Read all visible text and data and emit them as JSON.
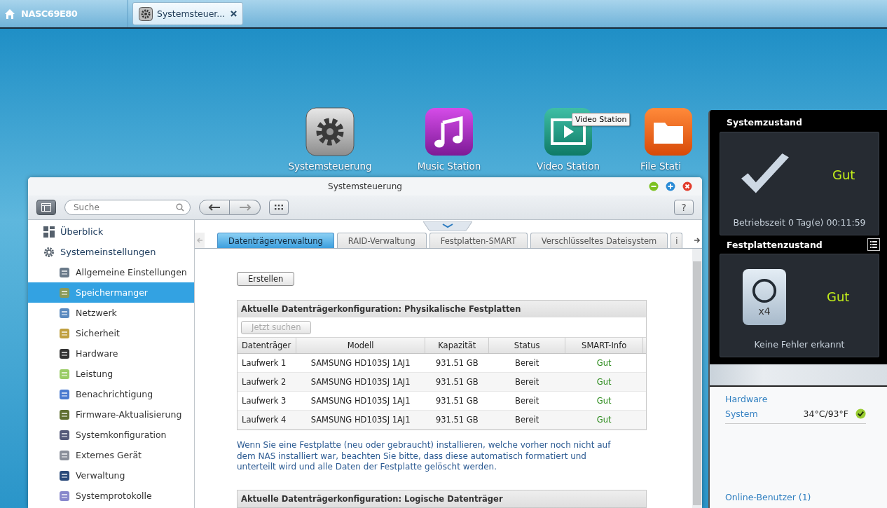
{
  "taskbar": {
    "home_label": "NASC69E80",
    "tabs": [
      {
        "label": "Systemsteuer...",
        "selected": true
      }
    ]
  },
  "desktop_icons": [
    {
      "label": "Systemsteuerung",
      "kind": "gear"
    },
    {
      "label": "Music Station",
      "kind": "music"
    },
    {
      "label": "Video Station",
      "kind": "video"
    },
    {
      "label": "File Stati",
      "kind": "folder"
    }
  ],
  "tooltip": "Video Station",
  "window": {
    "title": "Systemsteuerung",
    "search": {
      "placeholder": "Suche"
    },
    "help_label": "?",
    "sidebar": [
      {
        "label": "Überblick",
        "kind": "overview",
        "selected": false
      },
      {
        "label": "Systemeinstellungen",
        "kind": "settings",
        "selected": false,
        "children": [
          {
            "label": "Allgemeine Einstellungen",
            "selected": false
          },
          {
            "label": "Speichermanger",
            "selected": true
          },
          {
            "label": "Netzwerk",
            "selected": false
          },
          {
            "label": "Sicherheit",
            "selected": false
          },
          {
            "label": "Hardware",
            "selected": false
          },
          {
            "label": "Leistung",
            "selected": false
          },
          {
            "label": "Benachrichtigung",
            "selected": false
          },
          {
            "label": "Firmware-Aktualisierung",
            "selected": false
          },
          {
            "label": "Systemkonfiguration",
            "selected": false
          },
          {
            "label": "Externes Gerät",
            "selected": false
          },
          {
            "label": "Verwaltung",
            "selected": false
          },
          {
            "label": "Systemprotokolle",
            "selected": false
          }
        ]
      }
    ],
    "tabs": [
      {
        "label": "Datenträgerverwaltung",
        "selected": true
      },
      {
        "label": "RAID-Verwaltung",
        "selected": false
      },
      {
        "label": "Festplatten-SMART",
        "selected": false
      },
      {
        "label": "Verschlüsseltes Dateisystem",
        "selected": false
      },
      {
        "label": "i",
        "selected": false
      }
    ],
    "create_button": "Erstellen",
    "physical": {
      "title": "Aktuelle Datenträgerkonfiguration: Physikalische Festplatten",
      "scan_button": {
        "label": "Jetzt suchen",
        "disabled": true
      },
      "columns": [
        "Datenträger",
        "Modell",
        "Kapazität",
        "Status",
        "SMART-Info"
      ],
      "rows": [
        {
          "cells": [
            "Laufwerk 1",
            "SAMSUNG HD103SJ 1AJ1",
            "931.51 GB",
            "Bereit",
            "Gut"
          ]
        },
        {
          "cells": [
            "Laufwerk 2",
            "SAMSUNG HD103SJ 1AJ1",
            "931.51 GB",
            "Bereit",
            "Gut"
          ]
        },
        {
          "cells": [
            "Laufwerk 3",
            "SAMSUNG HD103SJ 1AJ1",
            "931.51 GB",
            "Bereit",
            "Gut"
          ]
        },
        {
          "cells": [
            "Laufwerk 4",
            "SAMSUNG HD103SJ 1AJ1",
            "931.51 GB",
            "Bereit",
            "Gut"
          ]
        }
      ]
    },
    "note": "Wenn Sie eine Festplatte (neu oder gebraucht) installieren, welche vorher noch nicht auf dem NAS installiert war, beachten Sie bitte, dass diese automatisch formatiert und unterteilt wird und alle Daten der Festplatte gelöscht werden.",
    "logical": {
      "title": "Aktuelle Datenträgerkonfiguration: Logische Datenträger"
    }
  },
  "widget": {
    "system": {
      "title": "Systemzustand",
      "status": "Gut",
      "uptime": "Betriebszeit 0 Tag(e) 00:11:59"
    },
    "disks": {
      "title": "Festplattenzustand",
      "count": "x4",
      "status": "Gut",
      "message": "Keine Fehler erkannt"
    },
    "hardware": {
      "title": "Hardware",
      "rows": [
        {
          "label": "System",
          "value": "34°C/93°F",
          "ok": true
        }
      ]
    },
    "online_users": "Online-Benutzer (1)"
  }
}
